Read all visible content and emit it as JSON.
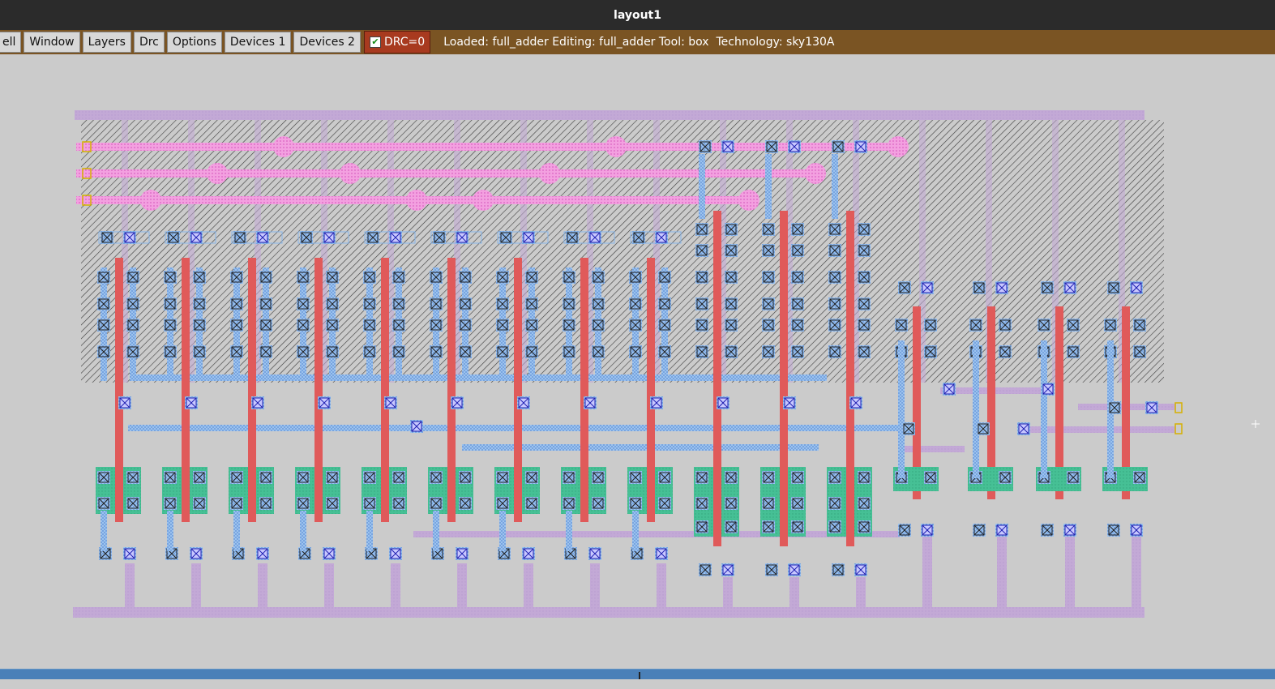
{
  "window": {
    "title": "layout1"
  },
  "menubar": {
    "items": [
      {
        "label": "Cell",
        "display": "ell",
        "name": "cell"
      },
      {
        "label": "Window",
        "display": "Window",
        "name": "window"
      },
      {
        "label": "Layers",
        "display": "Layers",
        "name": "layers"
      },
      {
        "label": "Drc",
        "display": "Drc",
        "name": "drc"
      },
      {
        "label": "Options",
        "display": "Options",
        "name": "options"
      },
      {
        "label": "Devices 1",
        "display": "Devices 1",
        "name": "devices-1"
      },
      {
        "label": "Devices 2",
        "display": "Devices 2",
        "name": "devices-2"
      }
    ],
    "drc_toggle": {
      "label": "DRC=0",
      "checked": true
    },
    "status": "Loaded: full_adder Editing: full_adder Tool: box  Technology: sky130A"
  },
  "colors": {
    "titlebar": "#2b2b2b",
    "menubar": "#7a5423",
    "drc_button": "#a83a1f",
    "canvas": "#cbcbcb",
    "metal1": "#c3a9d6",
    "locali": "#87b5e8",
    "poly": "#e05a5a",
    "diff": "#3fba8e",
    "met2": "#f07ad2",
    "contact_dark": "#3a3ac8",
    "nwell_hatch": "#333333",
    "scrollbar": "#4a80b8"
  },
  "layout": {
    "cell_name": "full_adder",
    "technology": "sky130A",
    "top_stages": 9,
    "mid_stages": 3,
    "right_stages": 4,
    "icons": [
      "contact-icon",
      "via-icon",
      "port-icon",
      "crosshair-icon"
    ]
  }
}
